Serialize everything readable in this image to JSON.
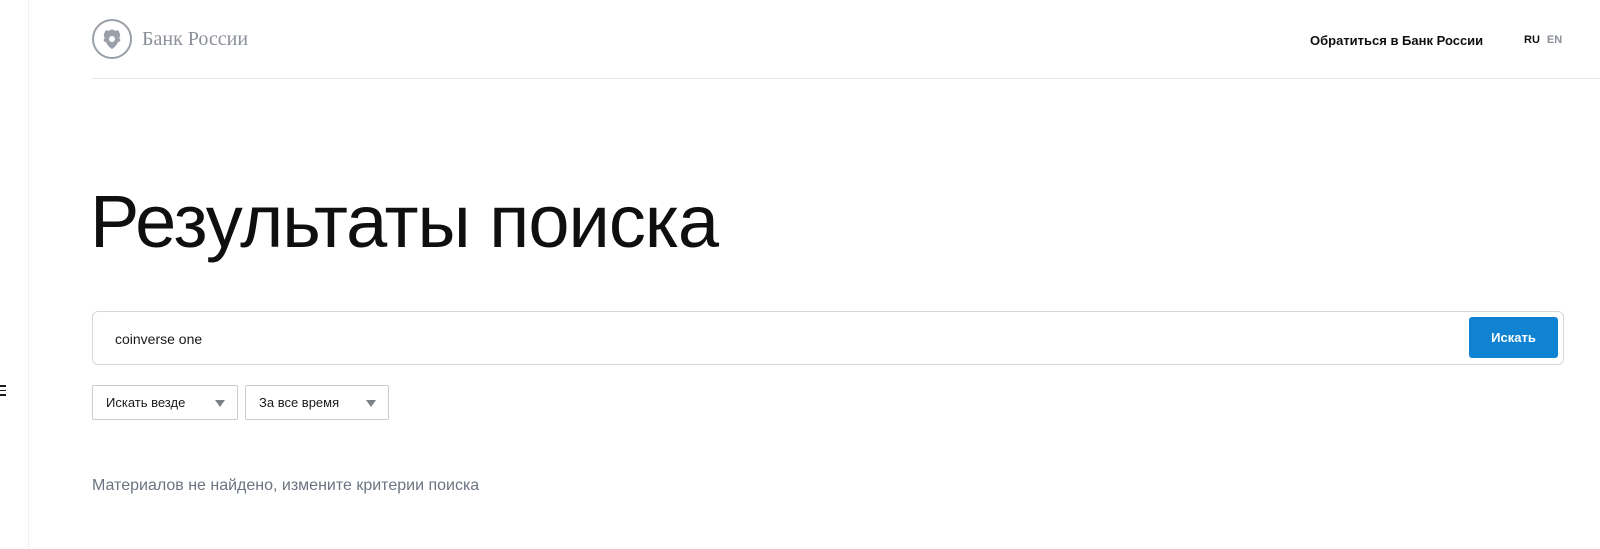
{
  "header": {
    "logo_text": "Банк России",
    "contact_link": "Обратиться в Банк России",
    "languages": {
      "active": "RU",
      "inactive": "EN"
    }
  },
  "main": {
    "title": "Результаты поиска",
    "search": {
      "value": "coinverse one",
      "button_label": "Искать"
    },
    "filters": {
      "scope": "Искать везде",
      "period": "За все время"
    },
    "empty_message": "Материалов не найдено, измените критерии поиска"
  },
  "colors": {
    "accent": "#0f83d1",
    "muted_text": "#6b7480"
  }
}
